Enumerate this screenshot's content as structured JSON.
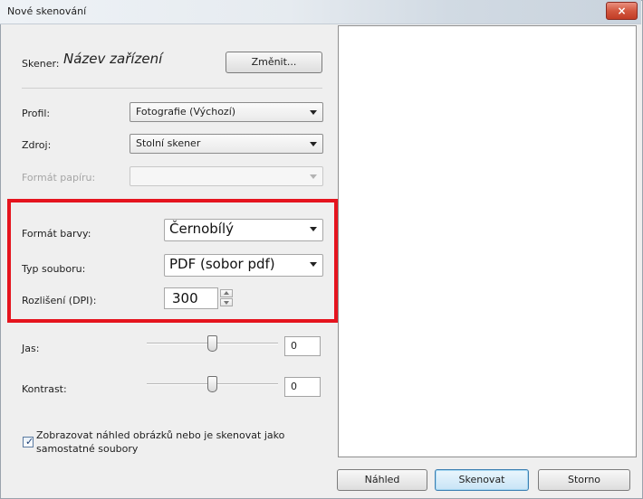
{
  "window": {
    "title": "Nové skenování",
    "close_icon": "×"
  },
  "scanner": {
    "label": "Skener:",
    "name": "Název zařízení",
    "change_button": "Změnit..."
  },
  "profile": {
    "label": "Profil:",
    "value": "Fotografie (Výchozí)"
  },
  "source": {
    "label": "Zdroj:",
    "value": "Stolní skener"
  },
  "paper_format": {
    "label": "Formát papíru:",
    "value": "",
    "disabled": true
  },
  "color_format": {
    "label": "Formát barvy:",
    "value": "Černobílý"
  },
  "file_type": {
    "label": "Typ souboru:",
    "value": "PDF (sobor pdf)"
  },
  "resolution": {
    "label": "Rozlišení (DPI):",
    "value": "300"
  },
  "brightness": {
    "label": "Jas:",
    "value": "0"
  },
  "contrast": {
    "label": "Kontrast:",
    "value": "0"
  },
  "preview_checkbox": {
    "checked": true,
    "label_line1": "Zobrazovat náhled obrázků nebo je skenovat jako",
    "label_line2": "samostatné soubory"
  },
  "buttons": {
    "preview": "Náhled",
    "scan": "Skenovat",
    "cancel": "Storno"
  },
  "colors": {
    "highlight": "#e5141e",
    "close_button": "#c23d26"
  }
}
